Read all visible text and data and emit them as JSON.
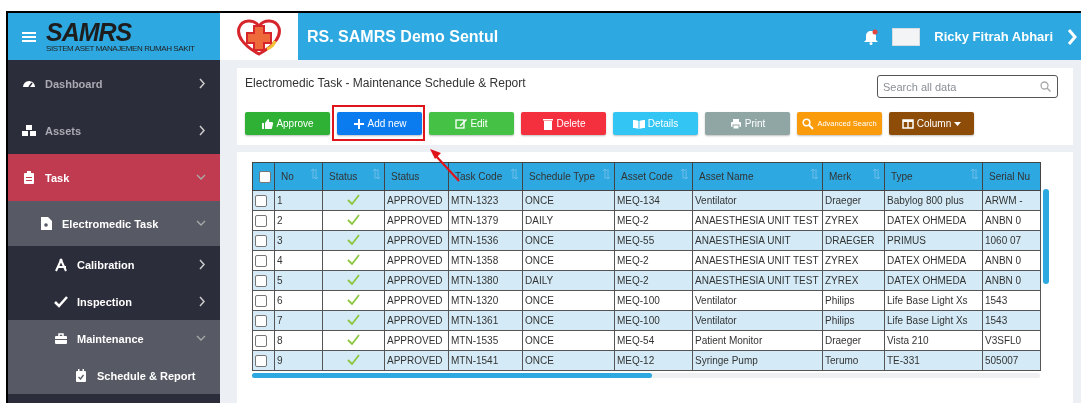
{
  "header": {
    "brand": "SAMRS",
    "brand_tagline": "SISTEM ASET MANAJEMEN RUMAH SAKIT",
    "hospital": "RS. SAMRS Demo Sentul",
    "user": "Ricky Fitrah Abhari"
  },
  "sidebar": {
    "items": [
      {
        "label": "Dashboard",
        "selected": false,
        "expanded": false
      },
      {
        "label": "Assets",
        "selected": false,
        "expanded": false
      },
      {
        "label": "Task",
        "selected": true,
        "expanded": true,
        "children": [
          {
            "label": "Electromedic Task",
            "selected": false,
            "expanded": true,
            "children": [
              {
                "label": "Calibration",
                "selected": false,
                "expanded": false
              },
              {
                "label": "Inspection",
                "selected": false,
                "expanded": false
              },
              {
                "label": "Maintenance",
                "selected": false,
                "expanded": true,
                "children": [
                  {
                    "label": "Schedule & Report",
                    "selected": false
                  }
                ]
              }
            ]
          }
        ]
      }
    ]
  },
  "page": {
    "title": "Electromedic Task - Maintenance Schedule & Report",
    "search": {
      "placeholder": "Search all data"
    }
  },
  "toolbar": {
    "buttons": [
      {
        "label": "Approve",
        "color": "#2eb135",
        "highlighted": false
      },
      {
        "label": "Add new",
        "color": "#0b7bf0",
        "highlighted": true
      },
      {
        "label": "Edit",
        "color": "#45c246",
        "highlighted": false
      },
      {
        "label": "Delete",
        "color": "#f5303e",
        "highlighted": false
      },
      {
        "label": "Details",
        "color": "#33c5f3",
        "highlighted": false
      },
      {
        "label": "Print",
        "color": "#8fa6a4",
        "highlighted": false
      },
      {
        "label": "Advanced Search",
        "color": "#f99b0b",
        "highlighted": false
      },
      {
        "label": "Column",
        "color": "#8d4c07",
        "highlighted": false
      }
    ]
  },
  "table": {
    "header_checked": false,
    "columns": [
      {
        "label": "No",
        "sortable": true
      },
      {
        "label": "Status",
        "sortable": true
      },
      {
        "label": "Status",
        "sortable": false
      },
      {
        "label": "Task Code",
        "sortable": true
      },
      {
        "label": "Schedule Type",
        "sortable": true
      },
      {
        "label": "Asset Code",
        "sortable": true
      },
      {
        "label": "Asset Name",
        "sortable": true
      },
      {
        "label": "Merk",
        "sortable": true
      },
      {
        "label": "Type",
        "sortable": true
      },
      {
        "label": "Serial Nu",
        "sortable": false
      }
    ],
    "rows": [
      {
        "checked": false,
        "approved": true,
        "cells": [
          "1",
          "",
          "APPROVED",
          "MTN-1323",
          "ONCE",
          "MEQ-134",
          "Ventilator",
          "Draeger",
          "Babylog 800 plus",
          "ARWM -"
        ]
      },
      {
        "checked": false,
        "approved": true,
        "cells": [
          "2",
          "",
          "APPROVED",
          "MTN-1379",
          "DAILY",
          "MEQ-2",
          "ANAESTHESIA UNIT TEST",
          "ZYREX",
          "DATEX OHMEDA",
          "ANBN 0"
        ]
      },
      {
        "checked": false,
        "approved": true,
        "cells": [
          "3",
          "",
          "APPROVED",
          "MTN-1536",
          "ONCE",
          "MEQ-55",
          "ANAESTHESIA UNIT",
          "DRAEGER",
          "PRIMUS",
          "1060 07"
        ]
      },
      {
        "checked": false,
        "approved": true,
        "cells": [
          "4",
          "",
          "APPROVED",
          "MTN-1358",
          "ONCE",
          "MEQ-2",
          "ANAESTHESIA UNIT TEST",
          "ZYREX",
          "DATEX OHMEDA",
          "ANBN 0"
        ]
      },
      {
        "checked": false,
        "approved": true,
        "cells": [
          "5",
          "",
          "APPROVED",
          "MTN-1380",
          "DAILY",
          "MEQ-2",
          "ANAESTHESIA UNIT TEST",
          "ZYREX",
          "DATEX OHMEDA",
          "ANBN 0"
        ]
      },
      {
        "checked": false,
        "approved": true,
        "cells": [
          "6",
          "",
          "APPROVED",
          "MTN-1320",
          "ONCE",
          "MEQ-100",
          "Ventilator",
          "Philips",
          "Life Base Light Xs",
          "1543"
        ]
      },
      {
        "checked": false,
        "approved": true,
        "cells": [
          "7",
          "",
          "APPROVED",
          "MTN-1361",
          "ONCE",
          "MEQ-100",
          "Ventilator",
          "Philips",
          "Life Base Light Xs",
          "1543"
        ]
      },
      {
        "checked": false,
        "approved": true,
        "cells": [
          "8",
          "",
          "APPROVED",
          "MTN-1535",
          "ONCE",
          "MEQ-54",
          "Patient Monitor",
          "Draeger",
          "Vista 210",
          "V3SFL0"
        ]
      },
      {
        "checked": false,
        "approved": true,
        "cells": [
          "9",
          "",
          "APPROVED",
          "MTN-1541",
          "ONCE",
          "MEQ-12",
          "Syringe Pump",
          "Terumo",
          "TE-331",
          "505007"
        ]
      }
    ]
  }
}
